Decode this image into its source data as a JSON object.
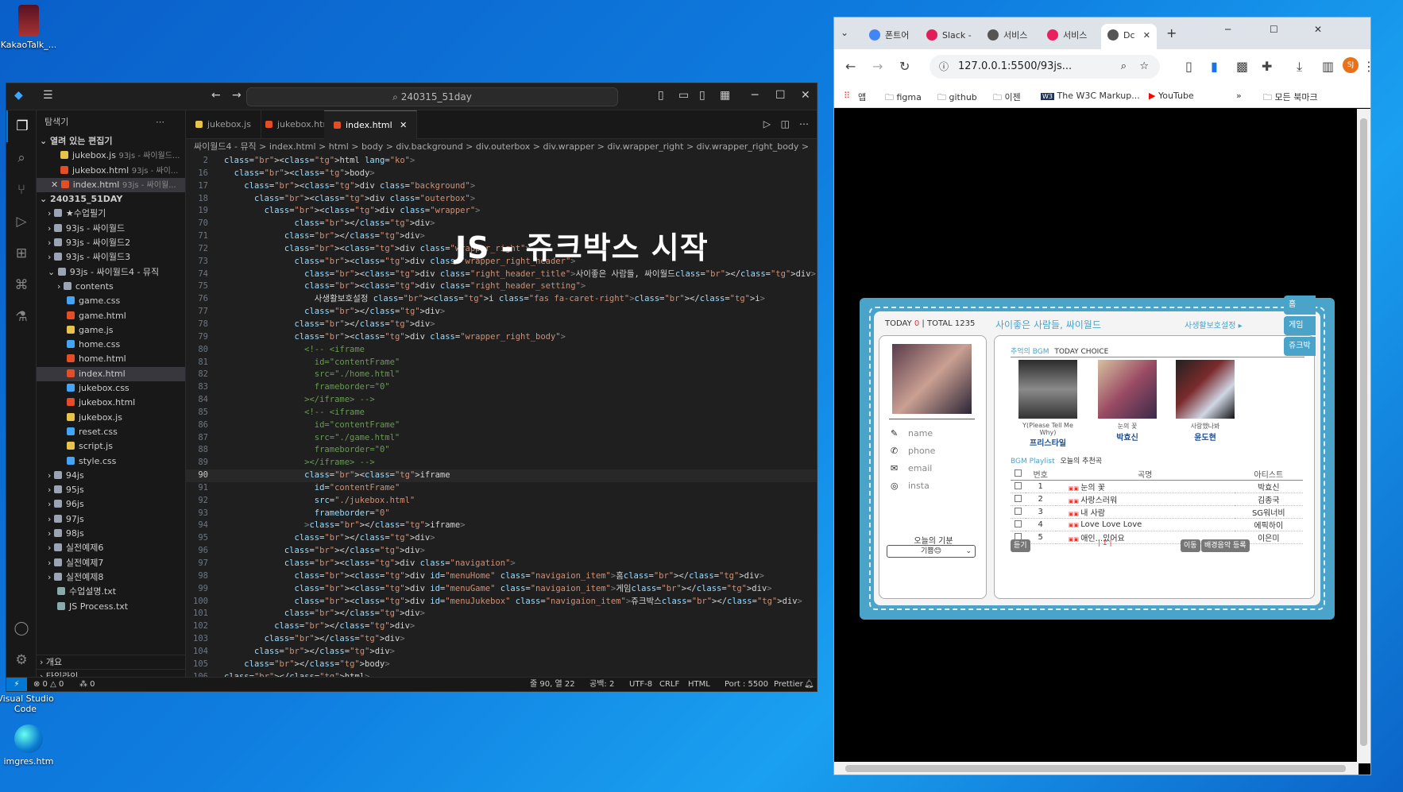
{
  "desktop": {
    "icons": [
      {
        "label": "KakaoTalk_..."
      },
      {
        "label": "Visual Studio Code"
      },
      {
        "label": "imgres.htm"
      }
    ]
  },
  "vscode": {
    "search": "240315_51day",
    "sidebar": {
      "title": "탐색기",
      "open_editors_label": "열려 있는 편집기",
      "open_editors": [
        {
          "name": "jukebox.js",
          "sub": "93js - 싸이월드..."
        },
        {
          "name": "jukebox.html",
          "sub": "93js - 싸이..."
        },
        {
          "name": "index.html",
          "sub": "93js - 싸이월..."
        }
      ],
      "root": "240315_51DAY",
      "tree": [
        {
          "name": "★수업필기",
          "kind": "folder",
          "depth": 1
        },
        {
          "name": "93js - 싸이월드",
          "kind": "folder",
          "depth": 1
        },
        {
          "name": "93js - 싸이월드2",
          "kind": "folder",
          "depth": 1
        },
        {
          "name": "93js - 싸이월드3",
          "kind": "folder",
          "depth": 1
        },
        {
          "name": "93js - 싸이월드4 - 뮤직",
          "kind": "folder-open",
          "depth": 1
        },
        {
          "name": "contents",
          "kind": "folder",
          "depth": 2
        },
        {
          "name": "game.css",
          "kind": "css",
          "depth": 2
        },
        {
          "name": "game.html",
          "kind": "html",
          "depth": 2
        },
        {
          "name": "game.js",
          "kind": "js",
          "depth": 2
        },
        {
          "name": "home.css",
          "kind": "css",
          "depth": 2
        },
        {
          "name": "home.html",
          "kind": "html",
          "depth": 2
        },
        {
          "name": "index.html",
          "kind": "html",
          "depth": 2,
          "selected": true
        },
        {
          "name": "jukebox.css",
          "kind": "css",
          "depth": 2
        },
        {
          "name": "jukebox.html",
          "kind": "html",
          "depth": 2
        },
        {
          "name": "jukebox.js",
          "kind": "js",
          "depth": 2
        },
        {
          "name": "reset.css",
          "kind": "css",
          "depth": 2
        },
        {
          "name": "script.js",
          "kind": "js",
          "depth": 2
        },
        {
          "name": "style.css",
          "kind": "css",
          "depth": 2
        },
        {
          "name": "94js",
          "kind": "folder",
          "depth": 1
        },
        {
          "name": "95js",
          "kind": "folder",
          "depth": 1
        },
        {
          "name": "96js",
          "kind": "folder",
          "depth": 1
        },
        {
          "name": "97js",
          "kind": "folder",
          "depth": 1
        },
        {
          "name": "98js",
          "kind": "folder",
          "depth": 1
        },
        {
          "name": "실전예제6",
          "kind": "folder",
          "depth": 1
        },
        {
          "name": "실전예제7",
          "kind": "folder",
          "depth": 1
        },
        {
          "name": "실전예제8",
          "kind": "folder",
          "depth": 1
        },
        {
          "name": "수업설명.txt",
          "kind": "txt",
          "depth": 1
        },
        {
          "name": "JS Process.txt",
          "kind": "txt",
          "depth": 1
        }
      ],
      "outline": "개요",
      "timeline": "타임라인"
    },
    "tabs": [
      {
        "name": "jukebox.js",
        "kind": "js"
      },
      {
        "name": "jukebox.html",
        "kind": "html"
      },
      {
        "name": "index.html",
        "kind": "html",
        "active": true
      }
    ],
    "breadcrumbs": "싸이월드4 - 뮤직 > index.html > html > body > div.background > div.outerbox > div.wrapper > div.wrapper_right > div.wrapper_right_body >",
    "overlay_title": "JS - 쥬크박스 시작",
    "code": [
      {
        "n": "2",
        "t": "<html lang=\"ko\">"
      },
      {
        "n": "16",
        "t": "  <body>"
      },
      {
        "n": "17",
        "t": "    <div class=\"background\">"
      },
      {
        "n": "18",
        "t": "      <div class=\"outerbox\">"
      },
      {
        "n": "19",
        "t": "        <div class=\"wrapper\">"
      },
      {
        "n": "70",
        "t": "              </div>"
      },
      {
        "n": "71",
        "t": "            </div>"
      },
      {
        "n": "72",
        "t": "            <div class=\"wrapper_right\">"
      },
      {
        "n": "73",
        "t": "              <div class=\"wrapper_right_header\">"
      },
      {
        "n": "74",
        "t": "                <div class=\"right_header_title\">사이좋은 사람들, 싸이월드</div>"
      },
      {
        "n": "75",
        "t": "                <div class=\"right_header_setting\">"
      },
      {
        "n": "76",
        "t": "                  사생활보호설정 <i class=\"fas fa-caret-right\"></i>"
      },
      {
        "n": "77",
        "t": "                </div>"
      },
      {
        "n": "78",
        "t": "              </div>"
      },
      {
        "n": "79",
        "t": "              <div class=\"wrapper_right_body\">"
      },
      {
        "n": "80",
        "t": "                <!-- <iframe"
      },
      {
        "n": "81",
        "t": "                  id=\"contentFrame\""
      },
      {
        "n": "82",
        "t": "                  src=\"./home.html\""
      },
      {
        "n": "83",
        "t": "                  frameborder=\"0\""
      },
      {
        "n": "84",
        "t": "                ></iframe> -->"
      },
      {
        "n": "85",
        "t": "                <!-- <iframe"
      },
      {
        "n": "86",
        "t": "                  id=\"contentFrame\""
      },
      {
        "n": "87",
        "t": "                  src=\"./game.html\""
      },
      {
        "n": "88",
        "t": "                  frameborder=\"0\""
      },
      {
        "n": "89",
        "t": "                ></iframe> -->"
      },
      {
        "n": "90",
        "t": "                <iframe",
        "cur": true
      },
      {
        "n": "91",
        "t": "                  id=\"contentFrame\""
      },
      {
        "n": "92",
        "t": "                  src=\"./jukebox.html\""
      },
      {
        "n": "93",
        "t": "                  frameborder=\"0\""
      },
      {
        "n": "94",
        "t": "                ></iframe>"
      },
      {
        "n": "95",
        "t": "              </div>"
      },
      {
        "n": "96",
        "t": "            </div>"
      },
      {
        "n": "97",
        "t": "            <div class=\"navigation\">"
      },
      {
        "n": "98",
        "t": "              <div id=\"menuHome\" class=\"navigaion_item\">홈</div>"
      },
      {
        "n": "99",
        "t": "              <div id=\"menuGame\" class=\"navigaion_item\">게임</div>"
      },
      {
        "n": "100",
        "t": "              <div id=\"menuJukebox\" class=\"navigaion_item\">쥬크박스</div>"
      },
      {
        "n": "101",
        "t": "            </div>"
      },
      {
        "n": "102",
        "t": "          </div>"
      },
      {
        "n": "103",
        "t": "        </div>"
      },
      {
        "n": "104",
        "t": "      </div>"
      },
      {
        "n": "105",
        "t": "    </body>"
      },
      {
        "n": "106",
        "t": "</html>"
      }
    ],
    "status": {
      "errors": "⊗ 0 △ 0",
      "ports": "⁂ 0",
      "position": "줄 90, 열 22",
      "spaces": "공백: 2",
      "encoding": "UTF-8",
      "eol": "CRLF",
      "language": "HTML",
      "port": "Port : 5500",
      "prettier": "Prettier"
    }
  },
  "chrome": {
    "tabs": [
      {
        "label": "폰트어",
        "color": "#4285f4"
      },
      {
        "label": "Slack -",
        "color": "#e01e5a"
      },
      {
        "label": "서비스",
        "color": "#555555"
      },
      {
        "label": "서비스",
        "color": "#e91e63"
      },
      {
        "label": "Dc",
        "color": "#555555",
        "active": true
      }
    ],
    "url": "127.0.0.1:5500/93js...",
    "profile": "SJ",
    "bookmarks": [
      "앱",
      "figma",
      "github",
      "이젠",
      "The W3C Markup...",
      "YouTube",
      "모든 북마크"
    ],
    "page": {
      "today_label": "TODAY",
      "today": "0",
      "total": "TOTAL 1235",
      "title": "사이좋은 사람들, 싸이월드",
      "privacy": "사생활보호설정",
      "profile_fields": [
        "name",
        "phone",
        "email",
        "insta"
      ],
      "mood_label": "오늘의 기분",
      "mood_value": "기쁨😊",
      "bgm_label": "추억의 BGM",
      "today_choice": "TODAY CHOICE",
      "albums": [
        {
          "sub": "Y(Please Tell Me Why)",
          "title": "프리스타일"
        },
        {
          "sub": "눈의 꽃",
          "title": "박효신"
        },
        {
          "sub": "사랑했나봐",
          "title": "윤도현"
        }
      ],
      "playlist_label": "BGM Playlist",
      "playlist_sub": "오늘의 추천곡",
      "columns": [
        "번호",
        "곡명",
        "아티스트"
      ],
      "songs": [
        {
          "no": "1",
          "title": "눈의 꽃",
          "artist": "박효신"
        },
        {
          "no": "2",
          "title": "사랑스러워",
          "artist": "김종국"
        },
        {
          "no": "3",
          "title": "내 사람",
          "artist": "SG워너비"
        },
        {
          "no": "4",
          "title": "Love Love Love",
          "artist": "에픽하이"
        },
        {
          "no": "5",
          "title": "애인...있어요",
          "artist": "이은미"
        }
      ],
      "listen_btn": "듣기",
      "pager": "| 1 |",
      "move_btn": "이동",
      "register_btn": "배경음악 등록",
      "side_menu": [
        "홈",
        "게임",
        "쥬크박스"
      ]
    }
  }
}
